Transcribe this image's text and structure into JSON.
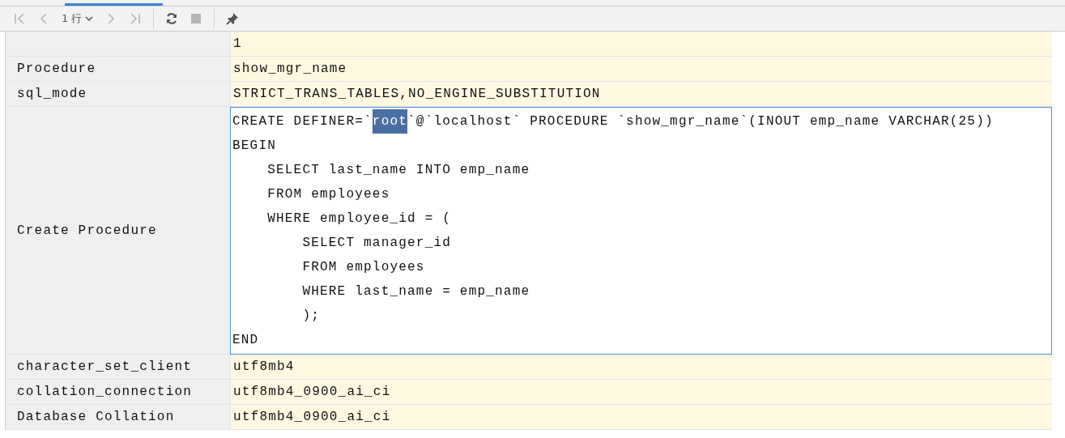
{
  "toolbar": {
    "buttons": [
      {
        "kind": "first",
        "disabled": true
      },
      {
        "kind": "prev",
        "disabled": true
      },
      {
        "kind": "rows",
        "label": "1 行",
        "disabled": false
      },
      {
        "kind": "next",
        "disabled": true
      },
      {
        "kind": "last",
        "disabled": true
      },
      {
        "kind": "separator"
      },
      {
        "kind": "refresh",
        "disabled": false
      },
      {
        "kind": "stop",
        "disabled": true
      },
      {
        "kind": "separator"
      },
      {
        "kind": "pin",
        "disabled": false
      }
    ]
  },
  "table": {
    "header": "1",
    "rows": [
      {
        "label": "Procedure",
        "value": "show_mgr_name"
      },
      {
        "label": "sql_mode",
        "value": "STRICT_TRANS_TABLES,NO_ENGINE_SUBSTITUTION"
      },
      {
        "label": "Create Procedure",
        "editing": true,
        "lines": [
          [
            {
              "text": "CREATE DEFINER=`",
              "selected": false
            },
            {
              "text": "root",
              "selected": true
            },
            {
              "text": "`@`localhost` PROCEDURE `show_mgr_name`(INOUT emp_name VARCHAR(25))",
              "selected": false
            }
          ],
          [
            {
              "text": "BEGIN",
              "selected": false
            }
          ],
          [
            {
              "text": "    SELECT last_name INTO emp_name",
              "selected": false
            }
          ],
          [
            {
              "text": "    FROM employees",
              "selected": false
            }
          ],
          [
            {
              "text": "    WHERE employee_id = (",
              "selected": false
            }
          ],
          [
            {
              "text": "        SELECT manager_id",
              "selected": false
            }
          ],
          [
            {
              "text": "        FROM employees",
              "selected": false
            }
          ],
          [
            {
              "text": "        WHERE last_name = emp_name",
              "selected": false
            }
          ],
          [
            {
              "text": "        );",
              "selected": false
            }
          ],
          [
            {
              "text": "END",
              "selected": false
            }
          ]
        ]
      },
      {
        "label": "character_set_client",
        "value": "utf8mb4"
      },
      {
        "label": "collation_connection",
        "value": "utf8mb4_0900_ai_ci"
      },
      {
        "label": "Database Collation",
        "value": "utf8mb4_0900_ai_ci"
      }
    ]
  }
}
